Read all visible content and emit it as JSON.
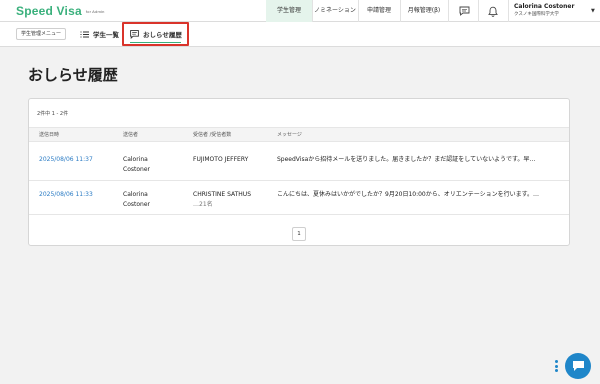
{
  "header": {
    "brand": "Speed Visa",
    "brand_sub": "for Admin",
    "nav": [
      {
        "label": "学生管理",
        "active": true
      },
      {
        "label": "ノミネーション",
        "active": false
      },
      {
        "label": "申請管理",
        "active": false
      },
      {
        "label": "月報管理(β)",
        "active": false
      }
    ],
    "user_name": "Calorina Costoner",
    "user_org": "クスノキ国際科学大学",
    "icons": [
      "chat-icon",
      "bell-icon",
      "chevron-down-icon"
    ]
  },
  "subbar": {
    "menu_label": "学生管理メニュー",
    "tabs": [
      {
        "label": "学生一覧",
        "icon": "list-icon",
        "active": false
      },
      {
        "label": "おしらせ履歴",
        "icon": "message-icon",
        "active": true
      }
    ]
  },
  "page": {
    "title": "おしらせ履歴",
    "count_text": "2件中 1 - 2件",
    "columns": [
      "送信日時",
      "送信者",
      "受信者 /受信者数",
      "メッセージ"
    ],
    "rows": [
      {
        "date": "2025/08/06 11:37",
        "sender_line1": "Calorina",
        "sender_line2": "Costoner",
        "recipient": "FUJIMOTO JEFFERY",
        "recipient_count": "",
        "message": "SpeedVisaから招待メールを送りました。届きましたか？まだ認証をしていないようです。早…"
      },
      {
        "date": "2025/08/06 11:33",
        "sender_line1": "Calorina",
        "sender_line2": "Costoner",
        "recipient": "CHRISTINE SATHUS",
        "recipient_count": "…21名",
        "message": "こんにちは、夏休みはいかがでしたか？9月20日10:00から、オリエンテーションを行います。…"
      }
    ],
    "pagination": {
      "current": "1"
    }
  },
  "colors": {
    "brand": "#3ab07c",
    "link": "#2a7bc4",
    "highlight": "#d9342b",
    "fab": "#1f86c9"
  }
}
